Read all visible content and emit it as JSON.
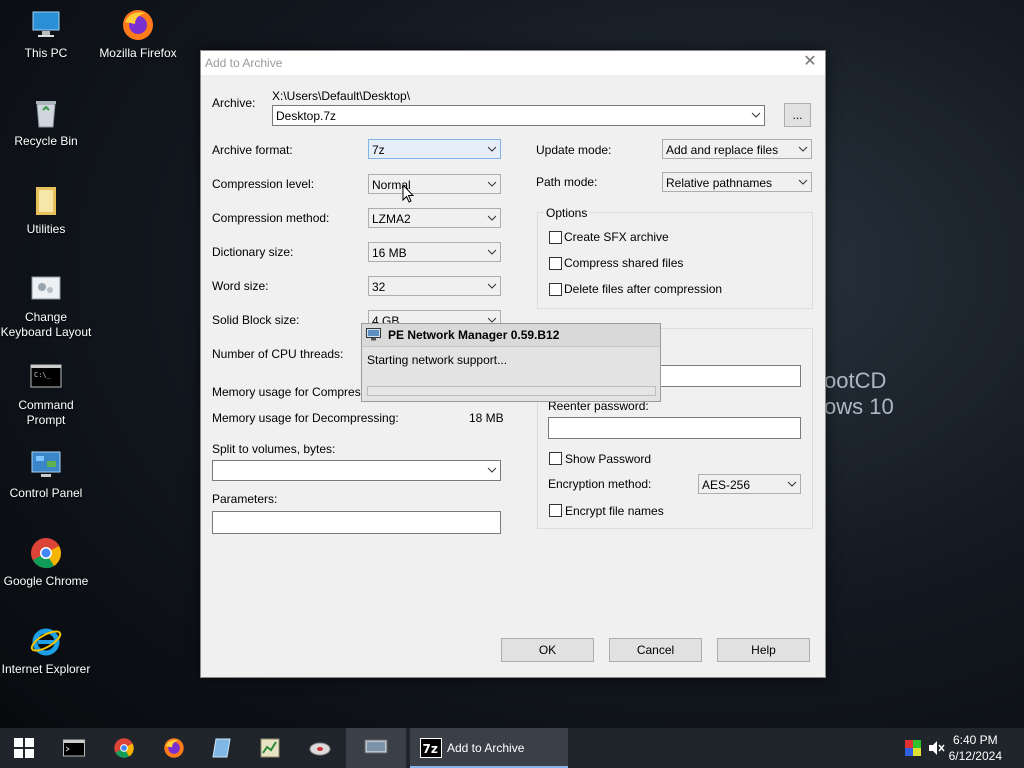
{
  "desktop": {
    "icons": [
      {
        "label": "This PC"
      },
      {
        "label": "Mozilla Firefox"
      },
      {
        "label": "Recycle Bin"
      },
      {
        "label": "Utilities"
      },
      {
        "label": "Change Keyboard Layout"
      },
      {
        "label": "Command Prompt"
      },
      {
        "label": "Control Panel"
      },
      {
        "label": "Google Chrome"
      },
      {
        "label": "Internet Explorer"
      }
    ],
    "background_text": {
      "line1": "ootCD",
      "line2": "ows 10"
    }
  },
  "dialog": {
    "title": "Add to Archive",
    "close_glyph": "✕",
    "archive_label": "Archive:",
    "archive_path": "X:\\Users\\Default\\Desktop\\",
    "archive_name": "Desktop.7z",
    "browse_label": "...",
    "format_label": "Archive format:",
    "format_value": "7z",
    "level_label": "Compression level:",
    "level_value": "Normal",
    "method_label": "Compression method:",
    "method_value": "LZMA2",
    "dict_label": "Dictionary size:",
    "dict_value": "16 MB",
    "word_label": "Word size:",
    "word_value": "32",
    "solid_label": "Solid Block size:",
    "solid_value": "4 GB",
    "threads_label": "Number of CPU threads:",
    "mem_comp_label": "Memory usage for Compressing:",
    "mem_decomp_label": "Memory usage for Decompressing:",
    "mem_decomp_value": "18 MB",
    "split_label": "Split to volumes, bytes:",
    "split_value": "",
    "params_label": "Parameters:",
    "params_value": "",
    "update_label": "Update mode:",
    "update_value": "Add and replace files",
    "path_label": "Path mode:",
    "path_value": "Relative pathnames",
    "options_label": "Options",
    "opt_sfx": "Create SFX archive",
    "opt_shared": "Compress shared files",
    "opt_delete": "Delete files after compression",
    "reenter_label": "Reenter password:",
    "show_password": "Show Password",
    "enc_method_label": "Encryption method:",
    "enc_method_value": "AES-256",
    "enc_names": "Encrypt file names",
    "ok": "OK",
    "cancel": "Cancel",
    "help": "Help"
  },
  "popup": {
    "title": "PE Network Manager 0.59.B12",
    "message": "Starting network support...",
    "progress": 0.0
  },
  "taskbar": {
    "active_window": "Add to Archive",
    "time": "6:40 PM",
    "date": "6/12/2024"
  },
  "colors": {
    "taskbar": "#20252b",
    "dialog_bg": "#f0f0f0",
    "accent": "#0078d7"
  }
}
